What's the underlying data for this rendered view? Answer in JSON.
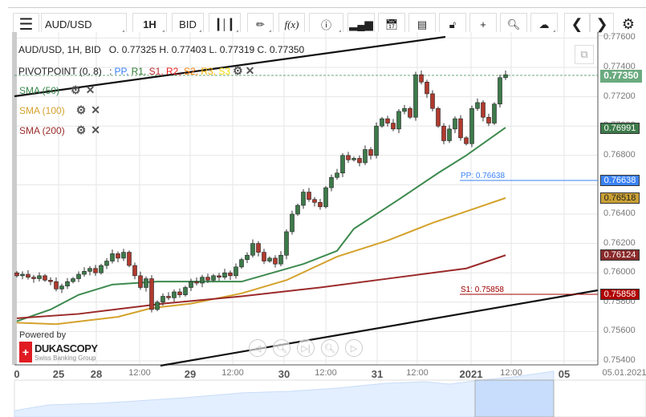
{
  "toolbar": {
    "menu_icon": "hamburger-icon",
    "symbol": "AUD/USD",
    "timeframe": "1H",
    "side": "BID",
    "fx": "f(x)"
  },
  "info": {
    "title": "AUD/USD, 1H, BID",
    "ohlc": "O. 0.77325 H. 0.77403 L. 0.77319 C. 0.77350"
  },
  "pivot": {
    "label": "PIVOTPOINT (0, 8)",
    "sep": ":",
    "items": [
      {
        "t": "PP",
        "c": "#3b82f6"
      },
      {
        "t": "R1",
        "c": "#2e7d32"
      },
      {
        "t": "S1",
        "c": "#c62828"
      },
      {
        "t": "R2",
        "c": "#ef1c1c"
      },
      {
        "t": "S2",
        "c": "#ff7f00"
      },
      {
        "t": "R3",
        "c": "#f5b400"
      },
      {
        "t": "S3",
        "c": "#f5d800"
      }
    ]
  },
  "indicators": [
    {
      "label": "SMA (50)",
      "color": "#3d8a4f"
    },
    {
      "label": "SMA (100)",
      "color": "#d4a22c"
    },
    {
      "label": "SMA (200)",
      "color": "#9b2a2a"
    }
  ],
  "branding": {
    "powered": "Powered by",
    "name": "DUKASCOPY",
    "sub": "Swiss Banking Group"
  },
  "chart_data": {
    "type": "candlestick",
    "instrument": "AUD/USD",
    "interval": "1H",
    "ylim": [
      0.7538,
      0.7762
    ],
    "yticks": [
      "0.77600",
      "0.77400",
      "0.77200",
      "0.77000",
      "0.76800",
      "0.76600",
      "0.76400",
      "0.76200",
      "0.76000",
      "0.75800",
      "0.75600",
      "0.75400"
    ],
    "xticks": [
      {
        "t": "0",
        "big": true
      },
      {
        "t": "25",
        "big": true
      },
      {
        "t": "28",
        "big": true
      },
      {
        "t": "12:00"
      },
      {
        "t": "29",
        "big": true
      },
      {
        "t": "12:00"
      },
      {
        "t": "30",
        "big": true
      },
      {
        "t": "12:00"
      },
      {
        "t": "31",
        "big": true
      },
      {
        "t": "12:00"
      },
      {
        "t": "2021",
        "big": true
      },
      {
        "t": "12:00"
      },
      {
        "t": "05",
        "big": true
      },
      {
        "t": "05.01.2021"
      }
    ],
    "closes": [
      0.7598,
      0.7599,
      0.7597,
      0.7596,
      0.7598,
      0.7595,
      0.7594,
      0.7589,
      0.7591,
      0.7594,
      0.7596,
      0.7599,
      0.7601,
      0.7603,
      0.76,
      0.7605,
      0.7608,
      0.7613,
      0.761,
      0.7614,
      0.7605,
      0.7598,
      0.759,
      0.7596,
      0.7575,
      0.758,
      0.7584,
      0.7583,
      0.7587,
      0.7585,
      0.759,
      0.7594,
      0.7593,
      0.7597,
      0.7595,
      0.7598,
      0.7597,
      0.76,
      0.7598,
      0.7604,
      0.7609,
      0.7612,
      0.762,
      0.7614,
      0.7608,
      0.761,
      0.7606,
      0.7612,
      0.7628,
      0.764,
      0.7646,
      0.7655,
      0.765,
      0.7648,
      0.7645,
      0.7658,
      0.7665,
      0.7668,
      0.768,
      0.7677,
      0.7678,
      0.7675,
      0.7684,
      0.768,
      0.77,
      0.7705,
      0.7702,
      0.7698,
      0.771,
      0.7712,
      0.7706,
      0.7735,
      0.773,
      0.7722,
      0.7712,
      0.77,
      0.769,
      0.7698,
      0.7705,
      0.7692,
      0.7688,
      0.7712,
      0.7716,
      0.7706,
      0.7702,
      0.7715,
      0.7733,
      0.7735
    ],
    "sma": [
      {
        "name": "SMA (50)",
        "color": "#3d8a4f",
        "last": "0.76991",
        "points": [
          [
            0,
            0.7567
          ],
          [
            6,
            0.7575
          ],
          [
            11,
            0.7585
          ],
          [
            17,
            0.7592
          ],
          [
            25,
            0.7594
          ],
          [
            40,
            0.7594
          ],
          [
            51,
            0.7606
          ],
          [
            57,
            0.7615
          ],
          [
            60,
            0.763
          ],
          [
            68,
            0.765
          ],
          [
            75,
            0.7668
          ],
          [
            80,
            0.768
          ],
          [
            87,
            0.7699
          ]
        ]
      },
      {
        "name": "SMA (100)",
        "color": "#d4a22c",
        "last": "0.76518",
        "points": [
          [
            0,
            0.7566
          ],
          [
            7,
            0.7565
          ],
          [
            18,
            0.757
          ],
          [
            24,
            0.7576
          ],
          [
            31,
            0.7579
          ],
          [
            40,
            0.7586
          ],
          [
            48,
            0.7595
          ],
          [
            57,
            0.7611
          ],
          [
            66,
            0.7622
          ],
          [
            74,
            0.7634
          ],
          [
            87,
            0.7651
          ]
        ]
      },
      {
        "name": "SMA (200)",
        "color": "#9b2a2a",
        "last": "0.76124",
        "points": [
          [
            0,
            0.7569
          ],
          [
            11,
            0.7572
          ],
          [
            26,
            0.7579
          ],
          [
            40,
            0.7584
          ],
          [
            54,
            0.759
          ],
          [
            68,
            0.7597
          ],
          [
            80,
            0.7603
          ],
          [
            87,
            0.7612
          ]
        ]
      }
    ],
    "pivot_levels": [
      {
        "name": "PP",
        "label": "PP: 0.76638",
        "value": "0.76638",
        "color": "#3b82f6"
      },
      {
        "name": "S1",
        "label": "S1: 0.75858",
        "value": "0.75858",
        "color": "#a00000"
      }
    ],
    "last_price": "0.77350",
    "last_color": "#6aaa7f"
  }
}
